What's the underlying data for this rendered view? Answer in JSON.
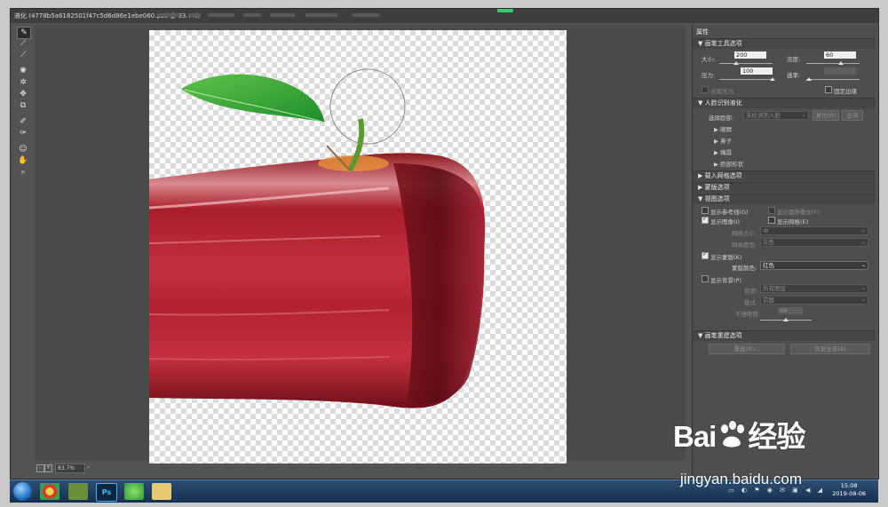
{
  "window": {
    "title": "液化 (4778b5a6182501f47c5d6d86e1ebe060.psd @ 83.7%)"
  },
  "toolbar": {
    "tools": [
      {
        "name": "forward-warp-tool-icon",
        "glyph": "✎"
      },
      {
        "name": "reconstruct-tool-icon",
        "glyph": "⟋"
      },
      {
        "name": "smooth-tool-icon",
        "glyph": "⟋"
      },
      {
        "name": "twirl-tool-icon",
        "glyph": "✺"
      },
      {
        "name": "pucker-tool-icon",
        "glyph": "✲"
      },
      {
        "name": "bloat-tool-icon",
        "glyph": "✥"
      },
      {
        "name": "push-left-tool-icon",
        "glyph": "⧉"
      },
      {
        "name": "freeze-mask-tool-icon",
        "glyph": "✐"
      },
      {
        "name": "thaw-mask-tool-icon",
        "glyph": "✑"
      },
      {
        "name": "face-tool-icon",
        "glyph": "☺"
      },
      {
        "name": "hand-tool-icon",
        "glyph": "✋"
      },
      {
        "name": "zoom-tool-icon",
        "glyph": "⌕"
      }
    ]
  },
  "status": {
    "zoom": "83.7%",
    "zoom_out": "-",
    "zoom_in": "+",
    "dd": "⌄"
  },
  "panel": {
    "title": "属性",
    "brush_section": "▼ 画笔工具选项",
    "size_label": "大小:",
    "size_value": "200",
    "density_label": "浓度:",
    "density_value": "60",
    "pressure_label": "压力:",
    "pressure_value": "100",
    "rate_label": "速率:",
    "stylus_label": "光笔压力",
    "pin_edges_label": "固定边缘",
    "face_section": "▼ 人脸识别液化",
    "select_face_label": "选择脸部:",
    "select_face_value": "未检测到人脸",
    "reset_label": "复位(R)",
    "all_label": "全部",
    "face_items": [
      "▶ 眼睛",
      "▶ 鼻子",
      "▶ 嘴唇",
      "▶ 脸部形状"
    ],
    "load_mesh_section": "▶ 载入网格选项",
    "mask_section": "▶ 蒙版选项",
    "view_section": "▼ 视图选项",
    "show_guides": "显示参考线(G)",
    "show_face_overlay": "显示面部叠加(F)",
    "show_image": "显示图像(I)",
    "show_mesh": "显示网格(E)",
    "mesh_size_label": "网格大小:",
    "mesh_size_value": "中",
    "mesh_color_label": "网格颜色:",
    "mesh_color_value": "灰色",
    "show_mask": "显示蒙版(K)",
    "mask_color_label": "蒙版颜色:",
    "mask_color_value": "红色",
    "show_backdrop": "显示背景(P)",
    "use_label": "使用:",
    "use_value": "所有图层",
    "mode_label": "模式:",
    "mode_value": "前面",
    "opacity_label": "不透明度:",
    "opacity_value": "50",
    "rebuild_section": "▼ 画笔重建选项",
    "rebuild_button": "重建(R)...",
    "restore_all_button": "恢复全部(A)"
  },
  "watermark": {
    "brand_a": "Bai",
    "brand_b": "经验",
    "url": "jingyan.baidu.com"
  },
  "taskbar": {
    "ps_label": "Ps",
    "time": "15:08",
    "date": "2019-08-06"
  }
}
